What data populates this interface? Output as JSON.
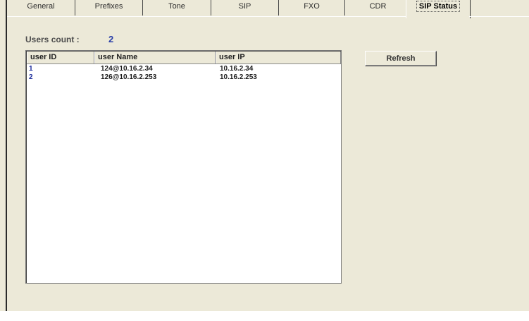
{
  "tabs": [
    {
      "label": "General"
    },
    {
      "label": "Prefixes"
    },
    {
      "label": "Tone"
    },
    {
      "label": "SIP"
    },
    {
      "label": "FXO"
    },
    {
      "label": "CDR"
    },
    {
      "label": "SIP Status",
      "active": true
    }
  ],
  "users_count": {
    "label": "Users count :",
    "value": "2"
  },
  "user_table": {
    "columns": [
      "user ID",
      "user Name",
      "user IP"
    ],
    "rows": [
      {
        "id": "1",
        "name": "124@10.16.2.34",
        "ip": "10.16.2.34"
      },
      {
        "id": "2",
        "name": "126@10.16.2.253",
        "ip": "10.16.2.253"
      }
    ]
  },
  "refresh_label": "Refresh",
  "colors": {
    "window_bg": "#ece9d8",
    "count_value": "#2a3fa8",
    "list_bg": "#ffffff"
  }
}
